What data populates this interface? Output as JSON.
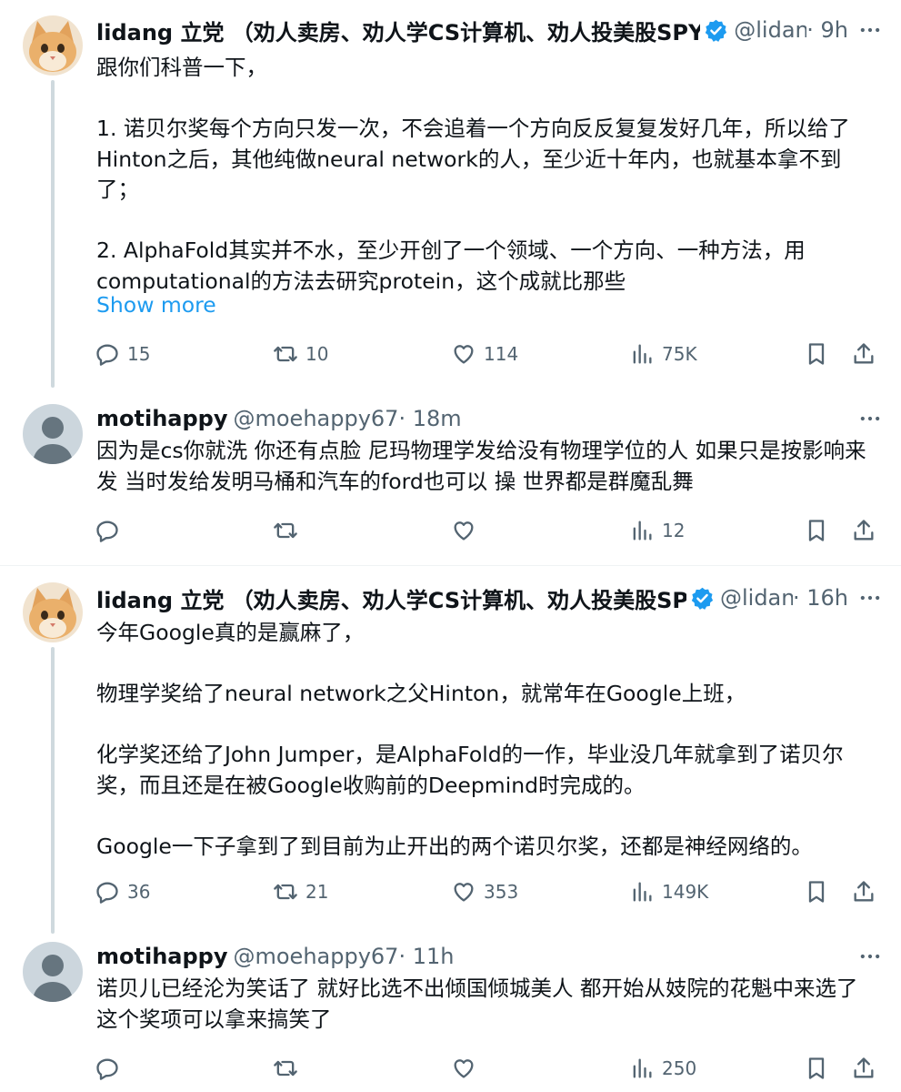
{
  "tweets": [
    {
      "author_name": "lidang 立党 （劝人卖房、劝人学CS计算机、劝人投美股SPY",
      "handle": "@lidangzzz",
      "time": "9h",
      "paragraphs": [
        "跟你们科普一下，",
        "1. 诺贝尔奖每个方向只发一次，不会追着一个方向反反复复发好几年，所以给了Hinton之后，其他纯做neural network的人，至少近十年内，也就基本拿不到了；",
        "2. AlphaFold其实并不水，至少开创了一个领域、一个方向、一种方法，用computational的方法去研究protein，这个成就比那些"
      ],
      "show_more": "Show more",
      "replies": "15",
      "reposts": "10",
      "likes": "114",
      "views": "75K"
    },
    {
      "author_name": "motihappy",
      "handle": "@moehappy67",
      "time": "18m",
      "paragraphs": [
        "因为是cs你就洗 你还有点脸 尼玛物理学发给没有物理学位的人 如果只是按影响来发 当时发给发明马桶和汽车的ford也可以 操 世界都是群魔乱舞"
      ],
      "replies": "",
      "reposts": "",
      "likes": "",
      "views": "12"
    },
    {
      "author_name": "lidang 立党 （劝人卖房、劝人学CS计算机、劝人投美股SPY",
      "handle": "@lidangzzz",
      "time": "16h",
      "paragraphs": [
        "今年Google真的是赢麻了，",
        "物理学奖给了neural network之父Hinton，就常年在Google上班，",
        "化学奖还给了John Jumper，是AlphaFold的一作，毕业没几年就拿到了诺贝尔奖，而且还是在被Google收购前的Deepmind时完成的。",
        "Google一下子拿到了到目前为止开出的两个诺贝尔奖，还都是神经网络的。"
      ],
      "replies": "36",
      "reposts": "21",
      "likes": "353",
      "views": "149K"
    },
    {
      "author_name": "motihappy",
      "handle": "@moehappy67",
      "time": "11h",
      "paragraphs": [
        "诺贝儿已经沦为笑话了 就好比选不出倾国倾城美人 都开始从妓院的花魁中来选了 这个奖项可以拿来搞笑了"
      ],
      "replies": "",
      "reposts": "",
      "likes": "",
      "views": "250"
    }
  ],
  "icons": {
    "verified": "verified-badge-icon",
    "more": "more-options-icon",
    "reply": "reply-icon",
    "repost": "repost-icon",
    "like": "like-icon",
    "views": "views-icon",
    "bookmark": "bookmark-icon",
    "share": "share-icon"
  },
  "colors": {
    "text": "#0f1419",
    "secondary": "#536471",
    "link": "#1d9bf0",
    "verified": "#1d9bf0",
    "thread_line": "#cfd9de"
  }
}
